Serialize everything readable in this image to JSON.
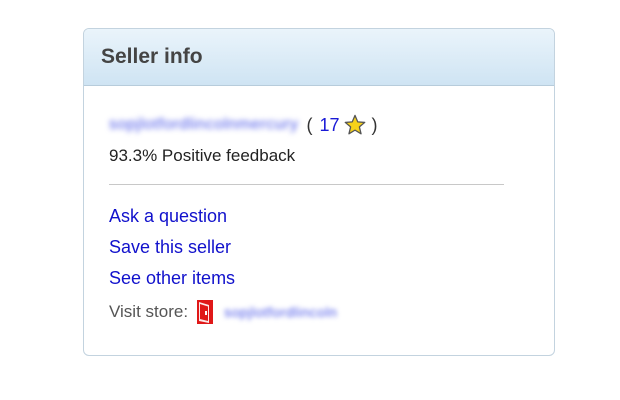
{
  "panel": {
    "title": "Seller info"
  },
  "seller": {
    "name": "sopjlotfordlincolnmercury",
    "paren_open": "(",
    "feedback_score": "17",
    "paren_close": ")",
    "positive_feedback": "93.3% Positive feedback"
  },
  "links": {
    "ask_question": "Ask a question",
    "save_seller": "Save this seller",
    "see_items": "See other items"
  },
  "store": {
    "label": "Visit store:",
    "name": "sopjlotfordlincoln"
  },
  "colors": {
    "link": "#1111cc",
    "header_gradient_top": "#eaf4fb",
    "header_gradient_bottom": "#cfe4f3",
    "star": "#f7d21a",
    "store_icon": "#e01818"
  },
  "icons": {
    "feedback_star": "yellow-star-icon",
    "store": "red-store-door-icon"
  }
}
